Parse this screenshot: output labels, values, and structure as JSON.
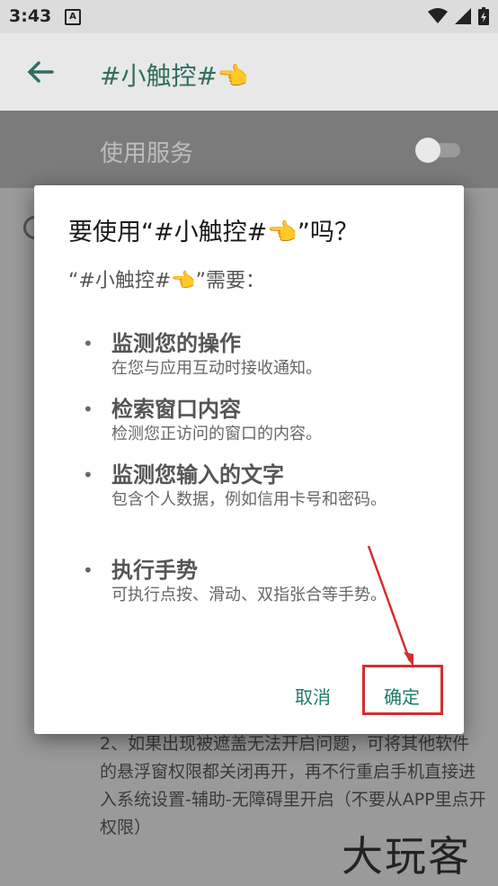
{
  "status_bar": {
    "time": "3:43",
    "notification_glyph": "A",
    "icons": [
      "wifi-icon",
      "signal-icon",
      "battery-icon"
    ]
  },
  "toolbar": {
    "title": "#小触控#👈"
  },
  "service": {
    "label": "使用服务",
    "enabled": false
  },
  "background": {
    "text": "2、如果出现被遮盖无法开启问题，可将其他软件的悬浮窗权限都关闭再开，再不行重启手机直接进入系统设置-辅助-无障碍里开启（不要从APP里点开权限）"
  },
  "dialog": {
    "title": "要使用“#小触控#👈”吗？",
    "subtitle": "“#小触控#👈”需要：",
    "permissions": [
      {
        "title": "监测您的操作",
        "desc": "在您与应用互动时接收通知。"
      },
      {
        "title": "检索窗口内容",
        "desc": "检测您正访问的窗口的内容。"
      },
      {
        "title": "监测您输入的文字",
        "desc": "包含个人数据，例如信用卡号和密码。"
      },
      {
        "title": "执行手势",
        "desc": "可执行点按、滑动、双指张合等手势。"
      }
    ],
    "cancel_label": "取消",
    "ok_label": "确定"
  },
  "watermark": "大玩客",
  "colors": {
    "accent": "#1f7a6a",
    "highlight": "#d32f2f",
    "scrim": "#9a9a9a"
  }
}
